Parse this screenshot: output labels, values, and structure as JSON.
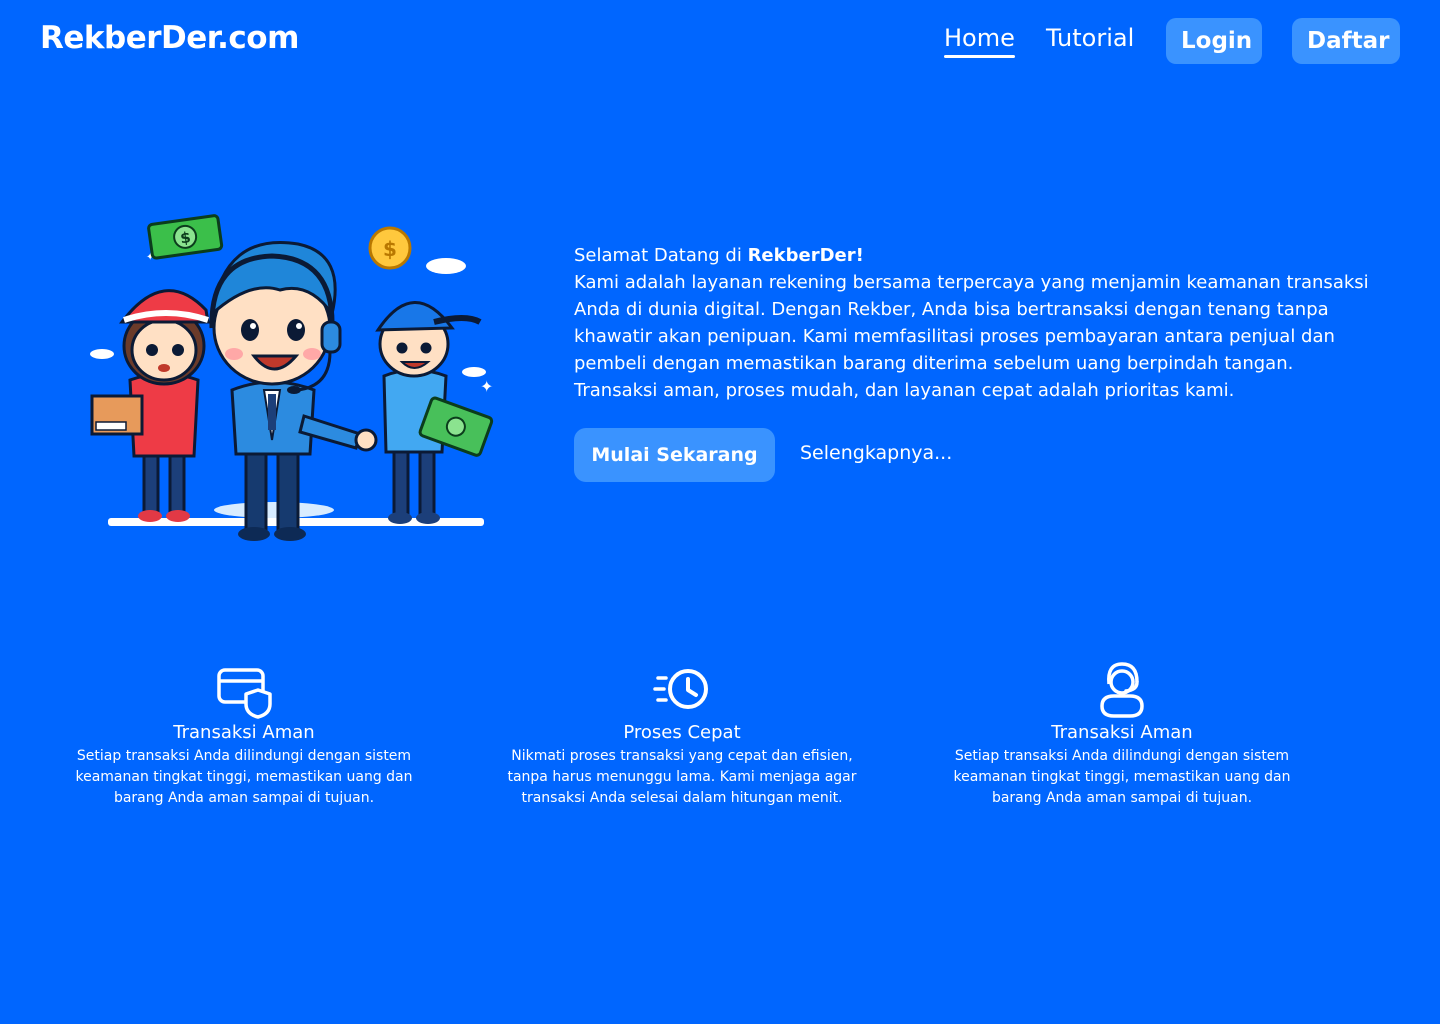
{
  "header": {
    "brand": "RekberDer.com",
    "nav": {
      "home": "Home",
      "tutorial": "Tutorial",
      "login": "Login",
      "daftar": "Daftar"
    }
  },
  "hero": {
    "welcome_prefix": "Selamat Datang di ",
    "welcome_brand": "RekberDer!",
    "description": "Kami adalah layanan rekening bersama terpercaya yang menjamin keamanan transaksi Anda di dunia digital. Dengan Rekber, Anda bisa bertransaksi dengan tenang tanpa khawatir akan penipuan. Kami memfasilitasi proses pembayaran antara penjual dan pembeli dengan memastikan barang diterima sebelum uang berpindah tangan. Transaksi aman, proses mudah, dan layanan cepat adalah prioritas kami.",
    "cta_primary": "Mulai Sekarang",
    "cta_secondary": "Selengkapnya...",
    "illustration": "customer-service-team-illustration"
  },
  "features": [
    {
      "icon": "card-shield-icon",
      "title": "Transaksi Aman",
      "description": "Setiap transaksi Anda dilindungi dengan sistem keamanan tingkat tinggi, memastikan uang dan barang Anda aman sampai di tujuan."
    },
    {
      "icon": "fast-clock-icon",
      "title": "Proses Cepat",
      "description": "Nikmati proses transaksi yang cepat dan efisien, tanpa harus menunggu lama. Kami menjaga agar transaksi Anda selesai dalam hitungan menit."
    },
    {
      "icon": "support-headset-icon",
      "title": "Transaksi Aman",
      "description": "Setiap transaksi Anda dilindungi dengan sistem keamanan tingkat tinggi, memastikan uang dan barang Anda aman sampai di tujuan."
    }
  ],
  "colors": {
    "background": "#0066ff",
    "button": "#3a93ff",
    "text": "#ffffff"
  }
}
